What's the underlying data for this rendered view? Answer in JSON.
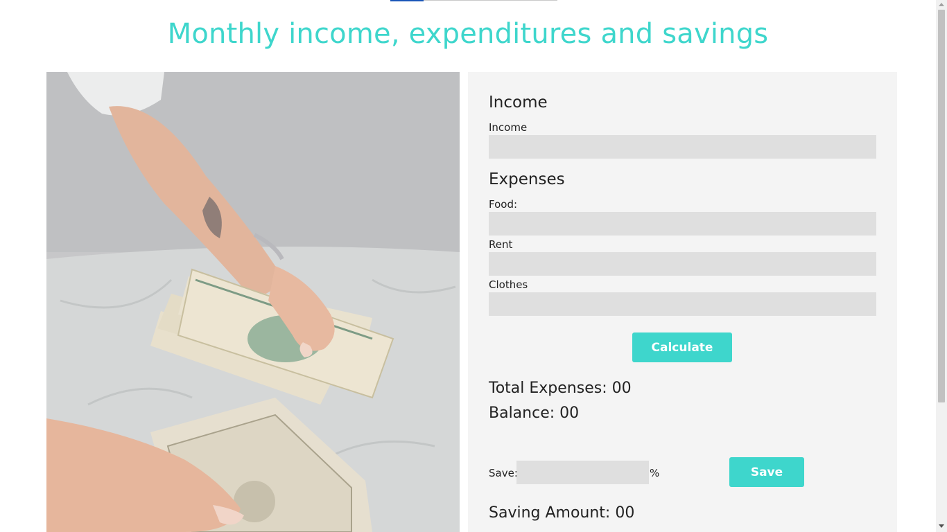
{
  "page": {
    "title": "Monthly income, expenditures and savings"
  },
  "colors": {
    "accent": "#3ed6cc",
    "panel_bg": "#f4f4f4",
    "field_bg": "#dfdfdf"
  },
  "income": {
    "heading": "Income",
    "label": "Income",
    "value": ""
  },
  "expenses": {
    "heading": "Expenses",
    "food_label": "Food:",
    "food_value": "",
    "rent_label": "Rent",
    "rent_value": "",
    "clothes_label": "Clothes",
    "clothes_value": ""
  },
  "calculate_label": "Calculate",
  "results": {
    "total_expenses_label": "Total Expenses: ",
    "total_expenses_value": "00",
    "balance_label": "Balance: ",
    "balance_value": "00"
  },
  "save": {
    "label": "Save:",
    "percent_value": "",
    "percent_sign": "%",
    "button_label": "Save",
    "saving_amount_label": "Saving Amount: ",
    "saving_amount_value": "00"
  }
}
